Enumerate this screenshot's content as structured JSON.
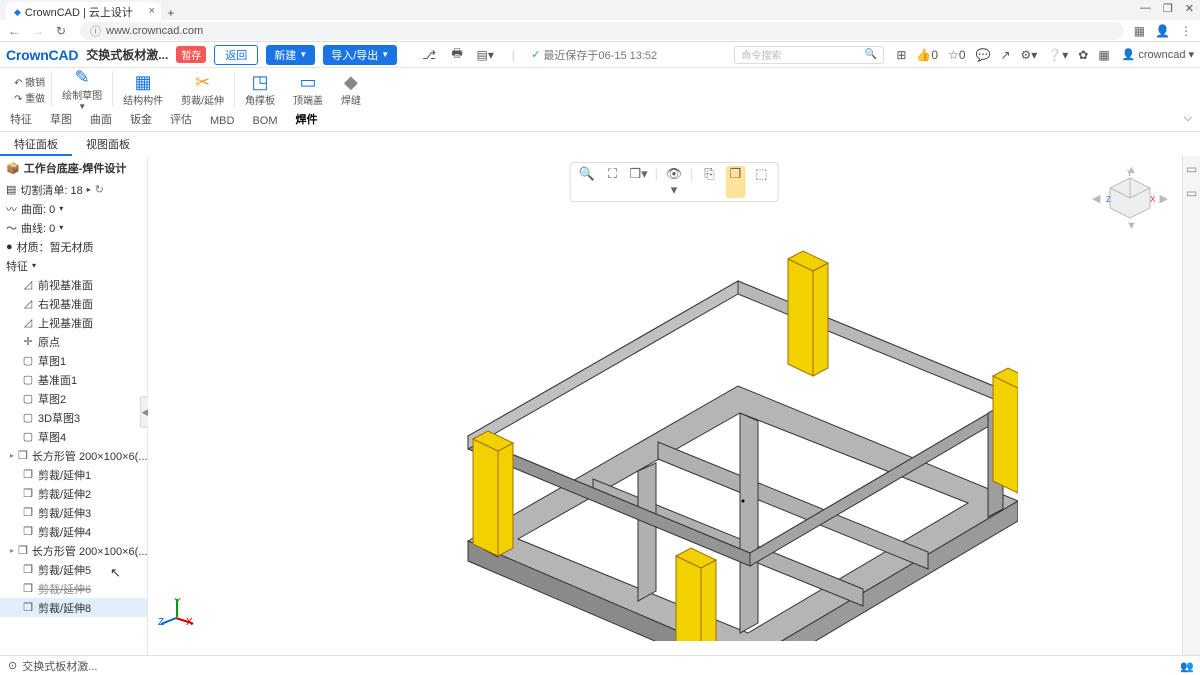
{
  "browser": {
    "tab_title": "CrownCAD | 云上设计",
    "url": "www.crowncad.com"
  },
  "window_buttons": {
    "min": "—",
    "max": "❐",
    "close": "✕"
  },
  "app": {
    "logo": "CrownCAD",
    "project_name": "交换式板材激...",
    "save_badge": "暂存",
    "btn_return": "返回",
    "btn_new": "新建",
    "btn_export": "导入/导出",
    "saved_text": "最近保存于06-15 13:52",
    "search_placeholder": "命令搜索",
    "like_count": "0",
    "comment_count": "0",
    "username": "crowncad"
  },
  "ribbon": {
    "small": {
      "a": "撤销",
      "b": "重做"
    },
    "draw": "绘制草图",
    "items": [
      {
        "icon": "▦",
        "label": "结构构件"
      },
      {
        "icon": "✂",
        "label": "剪裁/延伸"
      },
      {
        "icon": "◳",
        "label": "角撑板"
      },
      {
        "icon": "▭",
        "label": "顶端盖"
      },
      {
        "icon": "◆",
        "label": "焊缝"
      }
    ],
    "tabs": [
      "特征",
      "草图",
      "曲面",
      "钣金",
      "评估",
      "MBD",
      "BOM",
      "焊件"
    ],
    "active_tab": "焊件"
  },
  "panel_tabs": {
    "a": "特征面板",
    "b": "视图面板",
    "active": 0
  },
  "design": {
    "title": "工作台底座-焊件设计",
    "cut_list": "切割清单: 18",
    "surface": "曲面: 0",
    "curve": "曲线: 0",
    "material": "材质：暂无材质",
    "feature_header": "特征",
    "tree": [
      {
        "icon": "◿",
        "txt": "前视基准面"
      },
      {
        "icon": "◿",
        "txt": "右视基准面"
      },
      {
        "icon": "◿",
        "txt": "上视基准面"
      },
      {
        "icon": "✛",
        "txt": "原点"
      },
      {
        "icon": "▢",
        "txt": "草图1"
      },
      {
        "icon": "▢",
        "txt": "基准面1"
      },
      {
        "icon": "▢",
        "txt": "草图2"
      },
      {
        "icon": "▢",
        "txt": "3D草图3"
      },
      {
        "icon": "▢",
        "txt": "草图4"
      },
      {
        "icon": "❒",
        "txt": "长方形管 200×100×6(...",
        "exp": true
      },
      {
        "icon": "❒",
        "txt": "剪裁/延伸1"
      },
      {
        "icon": "❒",
        "txt": "剪裁/延伸2"
      },
      {
        "icon": "❒",
        "txt": "剪裁/延伸3"
      },
      {
        "icon": "❒",
        "txt": "剪裁/延伸4"
      },
      {
        "icon": "❒",
        "txt": "长方形管 200×100×6(...",
        "exp": true
      },
      {
        "icon": "❒",
        "txt": "剪裁/延伸5"
      },
      {
        "icon": "❒",
        "txt": "剪裁/延伸6",
        "strike": true
      },
      {
        "icon": "❒",
        "txt": "剪裁/延伸8",
        "sel": true
      }
    ]
  },
  "view_toolbar": [
    "🔍",
    "⛶",
    "❒▾",
    "—",
    "👁▾",
    "—",
    "⎘",
    "❐",
    "⬚"
  ],
  "status_tab": "交换式板材激..."
}
